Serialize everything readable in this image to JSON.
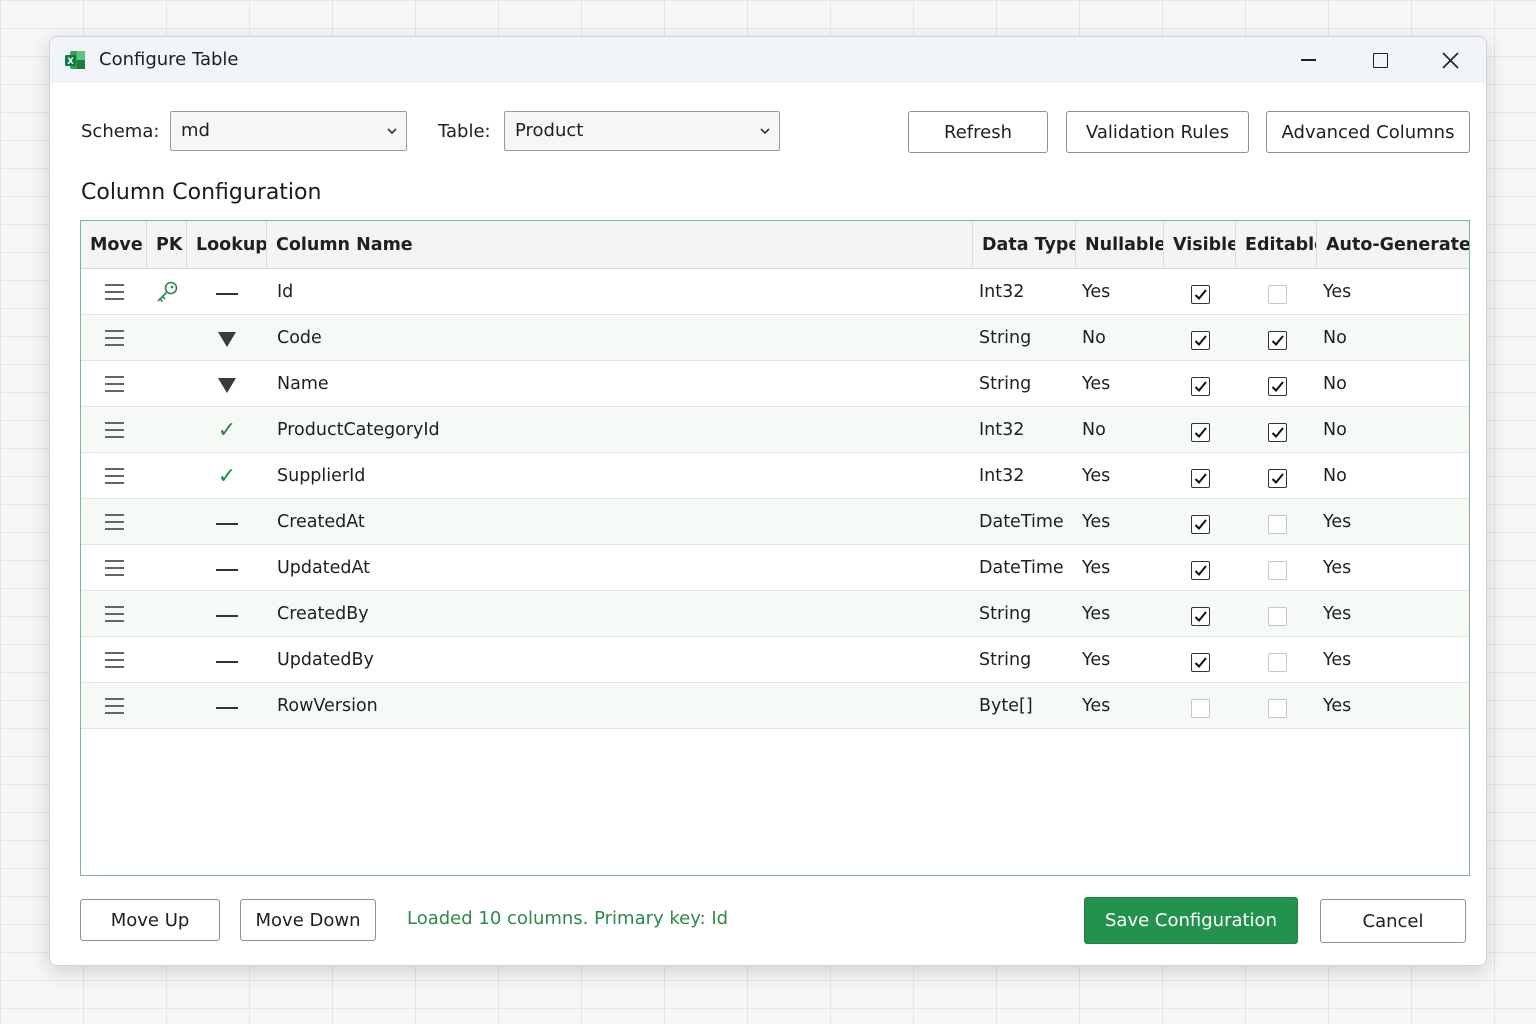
{
  "window": {
    "title": "Configure Table",
    "icon": "excel-icon"
  },
  "toolbar": {
    "schema_label": "Schema:",
    "schema_value": "md",
    "table_label": "Table:",
    "table_value": "Product",
    "refresh": "Refresh",
    "validation_rules": "Validation Rules",
    "advanced_columns": "Advanced Columns"
  },
  "section_title": "Column Configuration",
  "grid": {
    "headers": [
      "Move",
      "PK",
      "Lookup",
      "Column Name",
      "Data Type",
      "Nullable",
      "Visible",
      "Editable",
      "Auto-Generated"
    ],
    "rows": [
      {
        "pk": true,
        "lookup": "dash",
        "name": "Id",
        "type": "Int32",
        "nullable": "Yes",
        "visible": true,
        "editable": false,
        "auto": "Yes"
      },
      {
        "pk": false,
        "lookup": "arrow",
        "name": "Code",
        "type": "String",
        "nullable": "No",
        "visible": true,
        "editable": true,
        "auto": "No"
      },
      {
        "pk": false,
        "lookup": "arrow",
        "name": "Name",
        "type": "String",
        "nullable": "Yes",
        "visible": true,
        "editable": true,
        "auto": "No"
      },
      {
        "pk": false,
        "lookup": "check",
        "name": "ProductCategoryId",
        "type": "Int32",
        "nullable": "No",
        "visible": true,
        "editable": true,
        "auto": "No"
      },
      {
        "pk": false,
        "lookup": "check",
        "name": "SupplierId",
        "type": "Int32",
        "nullable": "Yes",
        "visible": true,
        "editable": true,
        "auto": "No"
      },
      {
        "pk": false,
        "lookup": "dash",
        "name": "CreatedAt",
        "type": "DateTime",
        "nullable": "Yes",
        "visible": true,
        "editable": false,
        "auto": "Yes"
      },
      {
        "pk": false,
        "lookup": "dash",
        "name": "UpdatedAt",
        "type": "DateTime",
        "nullable": "Yes",
        "visible": true,
        "editable": false,
        "auto": "Yes"
      },
      {
        "pk": false,
        "lookup": "dash",
        "name": "CreatedBy",
        "type": "String",
        "nullable": "Yes",
        "visible": true,
        "editable": false,
        "auto": "Yes"
      },
      {
        "pk": false,
        "lookup": "dash",
        "name": "UpdatedBy",
        "type": "String",
        "nullable": "Yes",
        "visible": true,
        "editable": false,
        "auto": "Yes"
      },
      {
        "pk": false,
        "lookup": "dash",
        "name": "RowVersion",
        "type": "Byte[]",
        "nullable": "Yes",
        "visible": false,
        "editable": false,
        "auto": "Yes"
      }
    ]
  },
  "footer": {
    "move_up": "Move Up",
    "move_down": "Move Down",
    "status": "Loaded 10 columns. Primary key: Id",
    "save": "Save Configuration",
    "cancel": "Cancel"
  },
  "colors": {
    "accent": "#24924f",
    "status_text": "#2d8a4a",
    "grid_border": "#7fb58f"
  }
}
